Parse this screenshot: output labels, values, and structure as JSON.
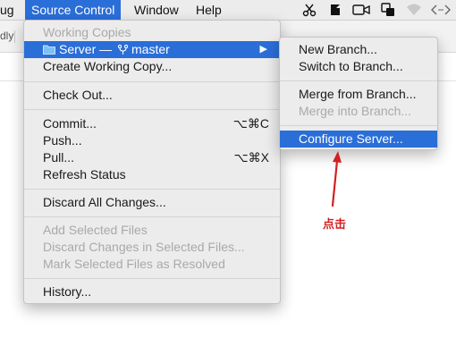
{
  "menubar": {
    "left_partial": "ug",
    "source_control": "Source Control",
    "window": "Window",
    "help": "Help"
  },
  "window_strip": {
    "partial_label": "dly"
  },
  "main_menu": {
    "section_header": "Working Copies",
    "server_item": "Server — ",
    "branch": "master",
    "create_working_copy": "Create Working Copy...",
    "check_out": "Check Out...",
    "commit": "Commit...",
    "commit_shortcut": "⌥⌘C",
    "push": "Push...",
    "pull": "Pull...",
    "pull_shortcut": "⌥⌘X",
    "refresh_status": "Refresh Status",
    "discard_all": "Discard All Changes...",
    "add_selected": "Add Selected Files",
    "discard_selected": "Discard Changes in Selected Files...",
    "mark_resolved": "Mark Selected Files as Resolved",
    "history": "History..."
  },
  "submenu": {
    "new_branch": "New Branch...",
    "switch_branch": "Switch to Branch...",
    "merge_from": "Merge from Branch...",
    "merge_into": "Merge into Branch...",
    "configure_server": "Configure Server..."
  },
  "annotation": {
    "text": "点击",
    "color": "#d42020"
  },
  "colors": {
    "highlight": "#2a6ed8",
    "menu_bg": "#ececec",
    "disabled": "#a9a9a9"
  }
}
